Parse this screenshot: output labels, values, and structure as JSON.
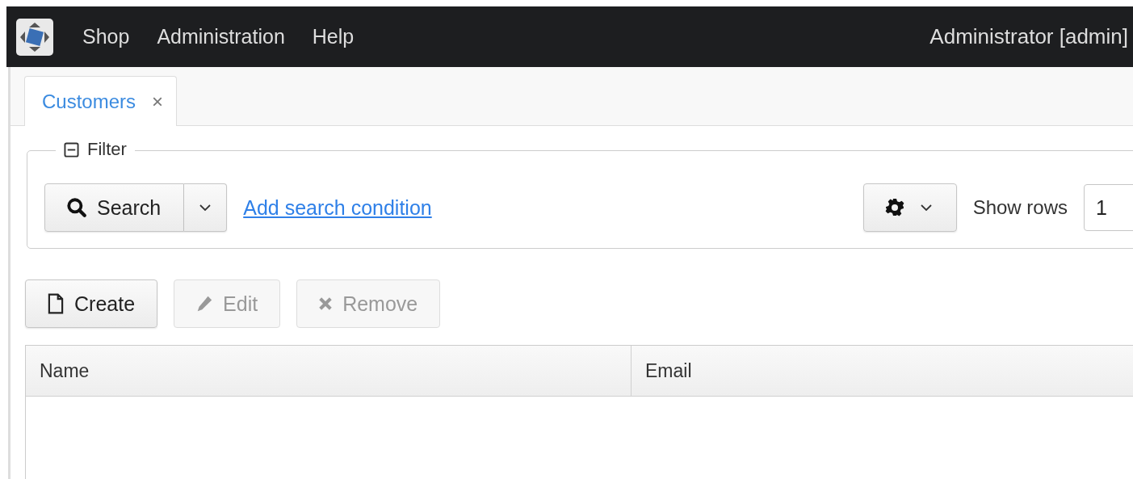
{
  "top_menu": {
    "items": [
      "Shop",
      "Administration",
      "Help"
    ],
    "user": "Administrator [admin]"
  },
  "tabs": [
    {
      "label": "Customers",
      "close": "×",
      "selected": true
    }
  ],
  "filter": {
    "title": "Filter",
    "expanded": true,
    "search_button": "Search",
    "add_condition_link": "Add search condition",
    "show_rows_label": "Show rows",
    "show_rows_value": "1"
  },
  "buttons": [
    {
      "label": "Create",
      "kind": "create",
      "disabled": false
    },
    {
      "label": "Edit",
      "kind": "edit",
      "disabled": true
    },
    {
      "label": "Remove",
      "kind": "remove",
      "disabled": true
    }
  ],
  "table": {
    "columns": [
      "Name",
      "Email"
    ]
  }
}
